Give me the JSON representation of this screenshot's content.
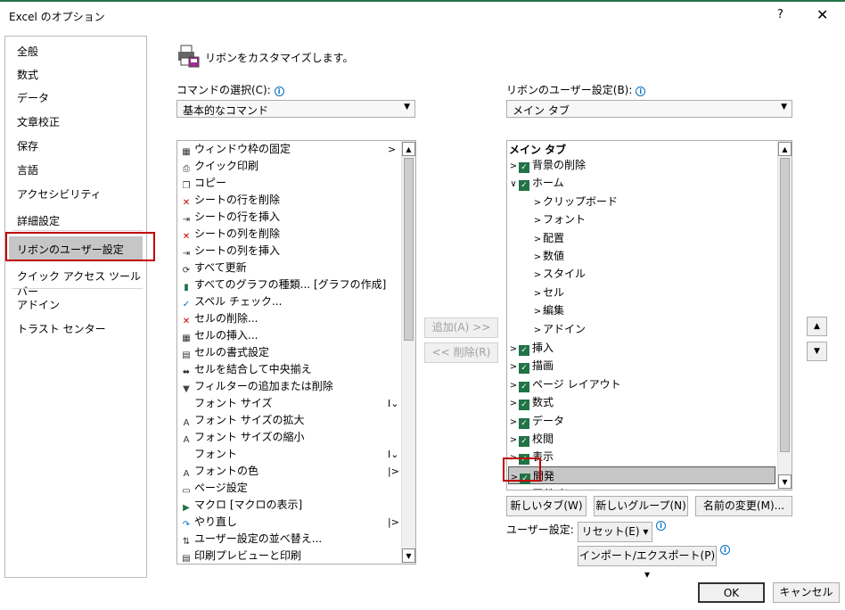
{
  "dialog": {
    "title": "Excel のオプション",
    "help": "?",
    "close": "✕"
  },
  "sidebar": {
    "items": [
      "全般",
      "数式",
      "データ",
      "文章校正",
      "保存",
      "言語",
      "アクセシビリティ",
      "詳細設定",
      "リボンのユーザー設定",
      "クイック アクセス ツール バー",
      "アドイン",
      "トラスト センター"
    ]
  },
  "header": "リボンをカスタマイズします。",
  "left": {
    "label": "コマンドの選択(C):",
    "combo": "基本的なコマンド",
    "commands": [
      {
        "label": "ウィンドウ枠の固定",
        "icon": "freeze-panes-icon",
        "sub": ">"
      },
      {
        "label": "クイック印刷",
        "icon": "quick-print-icon",
        "sub": ""
      },
      {
        "label": "コピー",
        "icon": "copy-icon",
        "sub": ""
      },
      {
        "label": "シートの行を削除",
        "icon": "delete-rows-icon",
        "sub": ""
      },
      {
        "label": "シートの行を挿入",
        "icon": "insert-rows-icon",
        "sub": ""
      },
      {
        "label": "シートの列を削除",
        "icon": "delete-columns-icon",
        "sub": ""
      },
      {
        "label": "シートの列を挿入",
        "icon": "insert-columns-icon",
        "sub": ""
      },
      {
        "label": "すべて更新",
        "icon": "refresh-all-icon",
        "sub": ""
      },
      {
        "label": "すべてのグラフの種類... [グラフの作成]",
        "icon": "chart-icon",
        "sub": ""
      },
      {
        "label": "スペル チェック...",
        "icon": "spell-check-icon",
        "sub": ""
      },
      {
        "label": "セルの削除...",
        "icon": "delete-cells-icon",
        "sub": ""
      },
      {
        "label": "セルの挿入...",
        "icon": "insert-cells-icon",
        "sub": ""
      },
      {
        "label": "セルの書式設定",
        "icon": "format-cells-icon",
        "sub": ""
      },
      {
        "label": "セルを結合して中央揃え",
        "icon": "merge-center-icon",
        "sub": ""
      },
      {
        "label": "フィルターの追加または削除",
        "icon": "filter-icon",
        "sub": ""
      },
      {
        "label": "フォント サイズ",
        "icon": "",
        "sub": "I⌄"
      },
      {
        "label": "フォント サイズの拡大",
        "icon": "font-grow-icon",
        "sub": ""
      },
      {
        "label": "フォント サイズの縮小",
        "icon": "font-shrink-icon",
        "sub": ""
      },
      {
        "label": "フォント",
        "icon": "",
        "sub": "I⌄"
      },
      {
        "label": "フォントの色",
        "icon": "font-color-icon",
        "sub": "|>"
      },
      {
        "label": "ページ設定",
        "icon": "page-setup-icon",
        "sub": ""
      },
      {
        "label": "マクロ [マクロの表示]",
        "icon": "macro-icon",
        "sub": ""
      },
      {
        "label": "やり直し",
        "icon": "redo-icon",
        "sub": "|>"
      },
      {
        "label": "ユーザー設定の並べ替え...",
        "icon": "sort-icon",
        "sub": ""
      },
      {
        "label": "印刷プレビューと印刷",
        "icon": "print-preview-icon",
        "sub": ""
      }
    ]
  },
  "middle": {
    "add": "追加(A) >>",
    "remove": "<< 削除(R)"
  },
  "right": {
    "label": "リボンのユーザー設定(B):",
    "combo": "メイン タブ",
    "header": "メイン タブ",
    "tree": [
      {
        "label": "背景の削除",
        "level": 0,
        "chev": ">",
        "checked": true
      },
      {
        "label": "ホーム",
        "level": 0,
        "chev": "∨",
        "checked": true
      },
      {
        "label": "クリップボード",
        "level": 1,
        "chev": ">",
        "checked": false
      },
      {
        "label": "フォント",
        "level": 1,
        "chev": ">",
        "checked": false
      },
      {
        "label": "配置",
        "level": 1,
        "chev": ">",
        "checked": false
      },
      {
        "label": "数値",
        "level": 1,
        "chev": ">",
        "checked": false
      },
      {
        "label": "スタイル",
        "level": 1,
        "chev": ">",
        "checked": false
      },
      {
        "label": "セル",
        "level": 1,
        "chev": ">",
        "checked": false
      },
      {
        "label": "編集",
        "level": 1,
        "chev": ">",
        "checked": false
      },
      {
        "label": "アドイン",
        "level": 1,
        "chev": ">",
        "checked": false
      },
      {
        "label": "挿入",
        "level": 0,
        "chev": ">",
        "checked": true
      },
      {
        "label": "描画",
        "level": 0,
        "chev": ">",
        "checked": true
      },
      {
        "label": "ページ レイアウト",
        "level": 0,
        "chev": ">",
        "checked": true
      },
      {
        "label": "数式",
        "level": 0,
        "chev": ">",
        "checked": true
      },
      {
        "label": "データ",
        "level": 0,
        "chev": ">",
        "checked": true
      },
      {
        "label": "校閲",
        "level": 0,
        "chev": ">",
        "checked": true
      },
      {
        "label": "表示",
        "level": 0,
        "chev": ">",
        "checked": true
      },
      {
        "label": "開発",
        "level": 0,
        "chev": ">",
        "checked": true
      },
      {
        "label": "アドイン",
        "level": 0,
        "chev": "",
        "checked": true
      }
    ],
    "new_tab": "新しいタブ(W)",
    "new_group": "新しいグループ(N)",
    "rename": "名前の変更(M)...",
    "user_settings": "ユーザー設定:",
    "reset": "リセット(E) ▾",
    "import_export": "インポート/エクスポート(P) ▾"
  },
  "footer": {
    "ok": "OK",
    "cancel": "キャンセル"
  },
  "colors": {
    "accent": "#217346",
    "highlight": "#c00000",
    "selected": "#c6c6c6"
  }
}
